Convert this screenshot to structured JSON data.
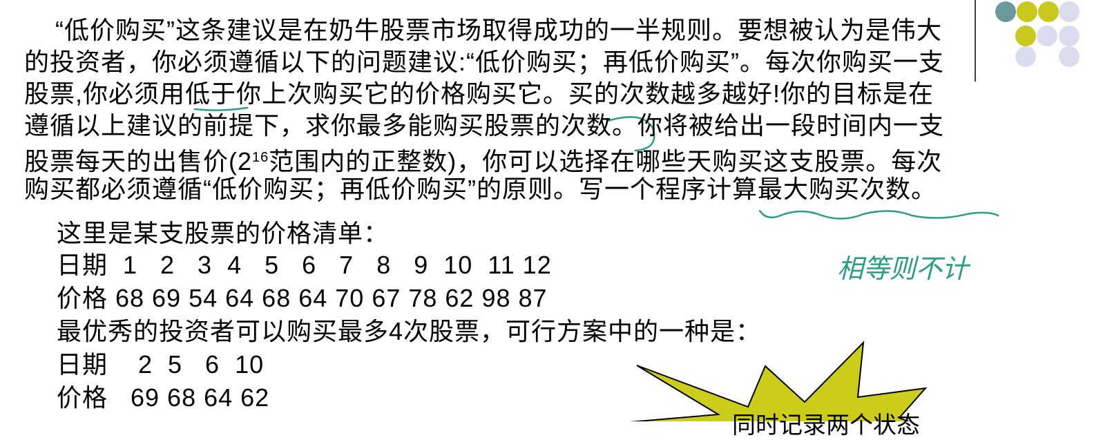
{
  "paragraph": {
    "lines": [
      "“低价购买”这条建议是在奶牛股票市场取得成功的一半规则。要想被认为是伟大",
      "的投资者，你必须遵循以下的问题建议:“低价购买；再低价购买”。每次你购买一支",
      "股票,你必须用低于你上次购买它的价格购买它。买的次数越多越好!你的目标是在",
      "遵循以上建议的前提下，求你最多能购买股票的次数。你将被给出一段时间内一支",
      "股票每天的出售价(2",
      "16",
      "范围内的正整数)，你可以选择在哪些天购买这支股票。每次",
      "购买都必须遵循“低价购买；再低价购买”的原则。写一个程序计算最大购买次数。"
    ]
  },
  "example": {
    "intro": "这里是某支股票的价格清单：",
    "days_row": "日期  1   2   3  4   5   6   7   8   9  10  11 12",
    "prices_row": "价格 68 69 54 64 68 64 70 67 78 62 98 87",
    "result": "最优秀的投资者可以购买最多4次股票，可行方案中的一种是：",
    "sol_days": "日期    2  5   6  10",
    "sol_prices": "价格   69 68 64 62"
  },
  "handwritten_note": "相等则不计",
  "callout_text": "同时记录两个状态",
  "colors": {
    "ink": "#2a9d84",
    "star_fill": "#cccc1a",
    "dot_teal": "#6a9a9c",
    "dot_yellow": "#c8c81e",
    "dot_lavender": "#dcdcef"
  }
}
